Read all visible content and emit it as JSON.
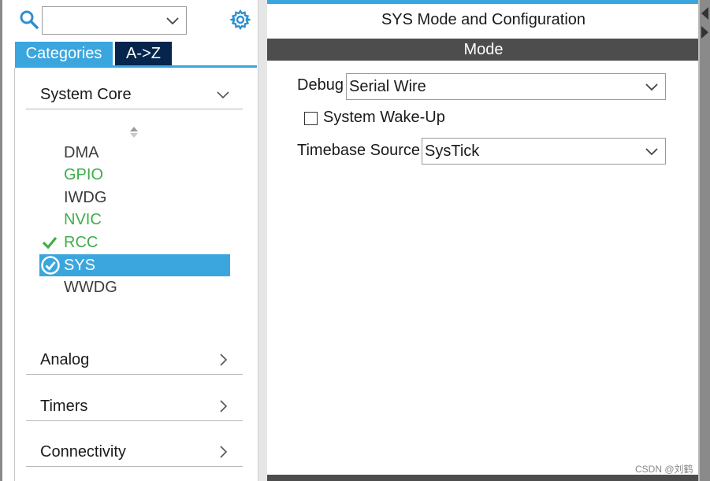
{
  "left": {
    "search": {
      "value": ""
    },
    "tabs": [
      {
        "label": "Categories",
        "active": true
      },
      {
        "label": "A->Z",
        "active": false
      }
    ],
    "categories": [
      {
        "label": "System Core",
        "expanded": true
      },
      {
        "label": "Analog",
        "expanded": false
      },
      {
        "label": "Timers",
        "expanded": false
      },
      {
        "label": "Connectivity",
        "expanded": false
      }
    ],
    "peripherals": [
      {
        "name": "DMA",
        "state": "default",
        "color": "#3c3c3c"
      },
      {
        "name": "GPIO",
        "state": "configured",
        "color": "#3fae49"
      },
      {
        "name": "IWDG",
        "state": "default",
        "color": "#3c3c3c"
      },
      {
        "name": "NVIC",
        "state": "configured",
        "color": "#3fae49"
      },
      {
        "name": "RCC",
        "state": "checked",
        "color": "#3fae49"
      },
      {
        "name": "SYS",
        "state": "selected",
        "color": "#ffffff"
      },
      {
        "name": "WWDG",
        "state": "default",
        "color": "#3c3c3c"
      }
    ]
  },
  "right": {
    "title": "SYS Mode and Configuration",
    "mode_header": "Mode",
    "debug": {
      "label": "Debug",
      "value": "Serial Wire"
    },
    "wakeup": {
      "label": "System Wake-Up",
      "checked": false
    },
    "timebase": {
      "label": "Timebase Source",
      "value": "SysTick"
    }
  },
  "watermark": "CSDN @刘鹤",
  "colors": {
    "accent": "#3aa6dd",
    "dark_tab": "#06254d",
    "header_bar": "#4d4d4d",
    "configured_green": "#3fae49"
  }
}
